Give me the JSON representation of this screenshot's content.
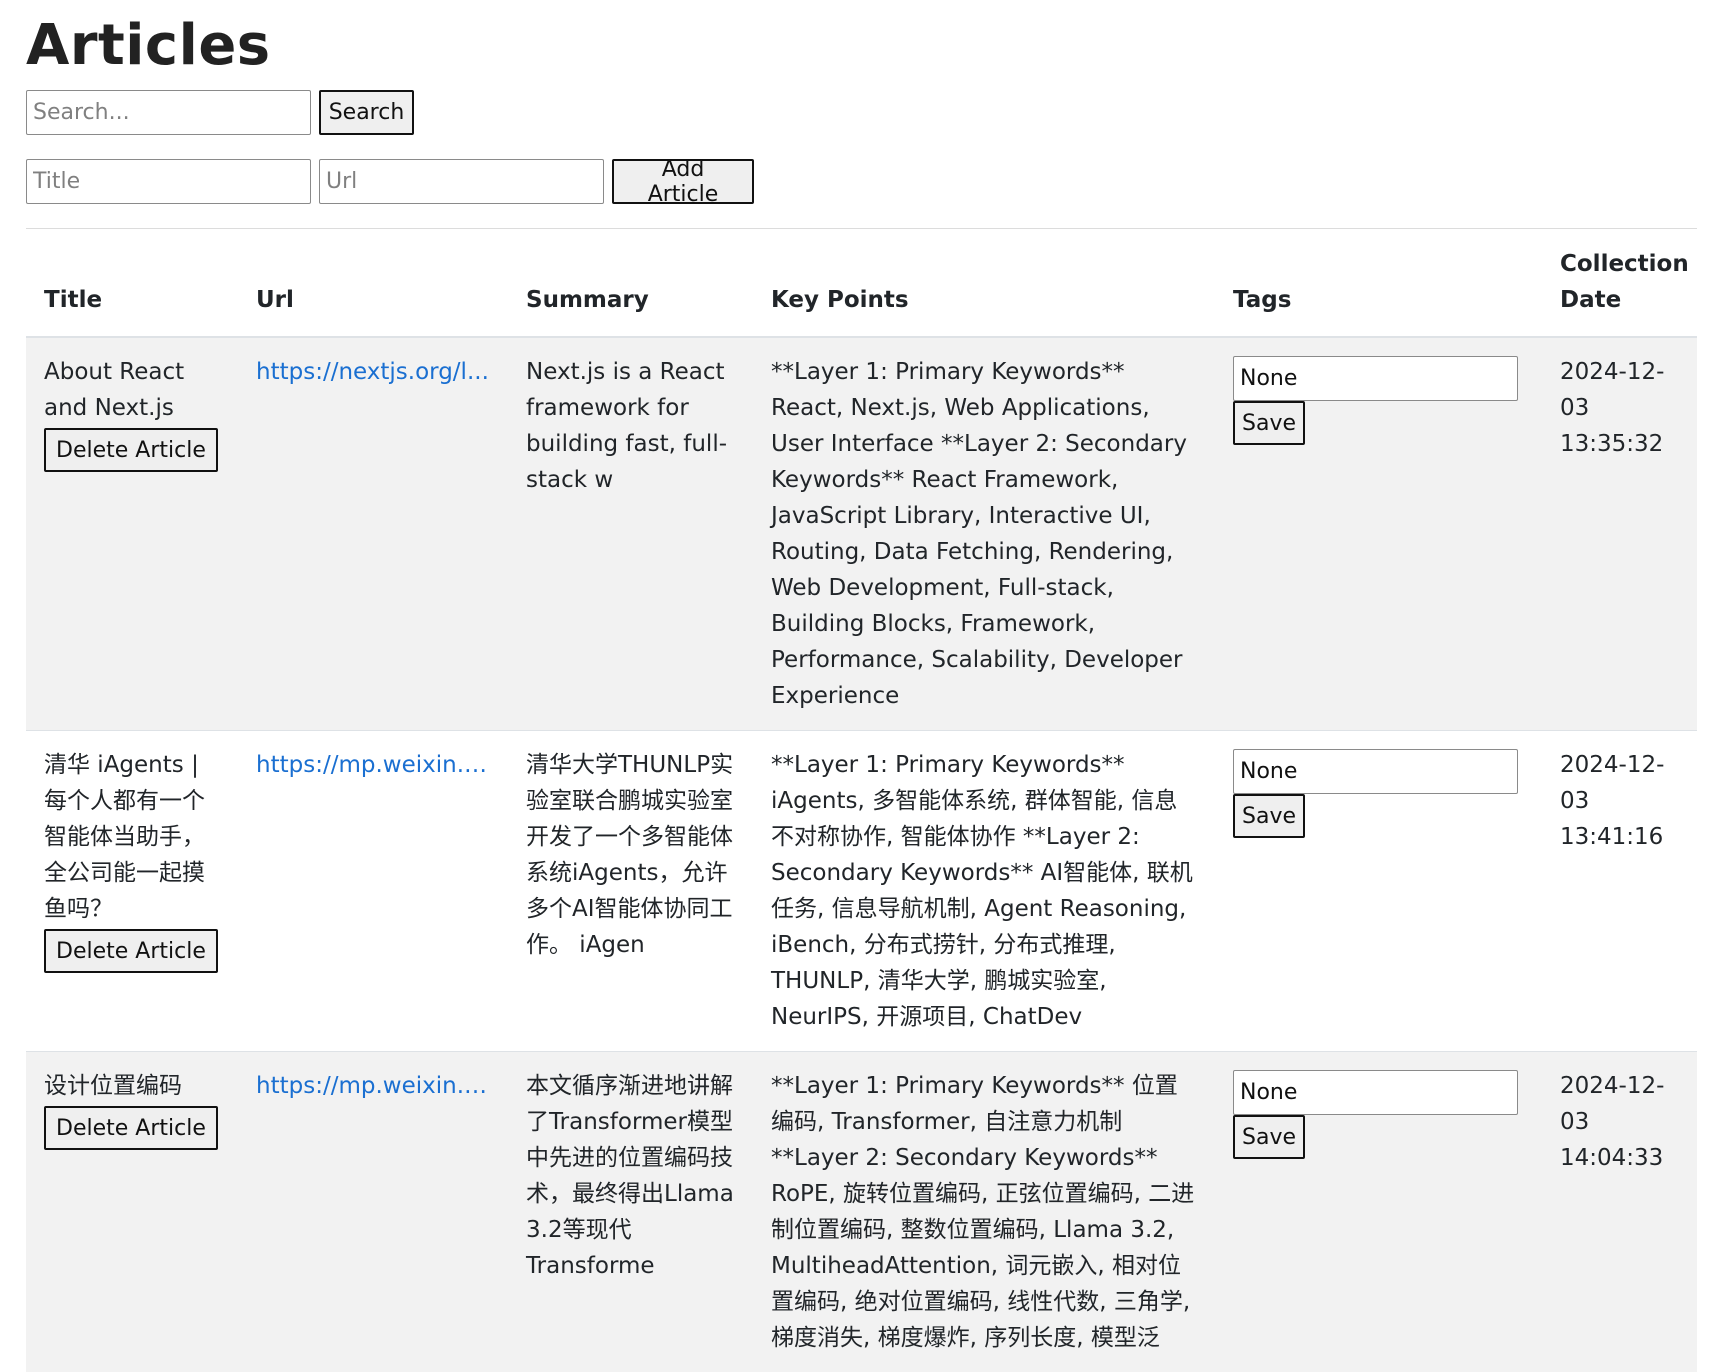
{
  "page": {
    "title": "Articles"
  },
  "search": {
    "placeholder": "Search...",
    "button_label": "Search"
  },
  "add_form": {
    "title_placeholder": "Title",
    "url_placeholder": "Url",
    "button_label": "Add Article"
  },
  "table": {
    "headers": {
      "title": "Title",
      "url": "Url",
      "summary": "Summary",
      "key_points": "Key Points",
      "tags": "Tags",
      "collection_date": "Collection Date"
    },
    "delete_label": "Delete Article",
    "save_label": "Save",
    "rows": [
      {
        "title": "About React and Next.js",
        "url": "https://nextjs.org/l...",
        "summary": "Next.js is a React framework for building fast, full-stack w",
        "key_points": "**Layer 1: Primary Keywords** React, Next.js, Web Applications, User Interface **Layer 2: Secondary Keywords** React Framework, JavaScript Library, Interactive UI, Routing, Data Fetching, Rendering, Web Development, Full-stack, Building Blocks, Framework, Performance, Scalability, Developer Experience",
        "tags": "None",
        "collection_date": "2024-12-03 13:35:32"
      },
      {
        "title": "清华 iAgents | 每个人都有一个智能体当助手，全公司能一起摸鱼吗？",
        "url": "https://mp.weixin.qq...",
        "summary": "清华大学THUNLP实验室联合鹏城实验室开发了一个多智能体系统iAgents，允许多个AI智能体协同工作。 iAgen",
        "key_points": "**Layer 1: Primary Keywords** iAgents, 多智能体系统, 群体智能, 信息不对称协作, 智能体协作 **Layer 2: Secondary Keywords** AI智能体, 联机任务, 信息导航机制, Agent Reasoning, iBench, 分布式捞针, 分布式推理, THUNLP, 清华大学, 鹏城实验室, NeurIPS, 开源项目, ChatDev",
        "tags": "None",
        "collection_date": "2024-12-03 13:41:16"
      },
      {
        "title": "设计位置编码",
        "url": "https://mp.weixin.qq...",
        "summary": "本文循序渐进地讲解了Transformer模型中先进的位置编码技术，最终得出Llama 3.2等现代Transforme",
        "key_points": "**Layer 1: Primary Keywords** 位置编码, Transformer, 自注意力机制 **Layer 2: Secondary Keywords** RoPE, 旋转位置编码, 正弦位置编码, 二进制位置编码, 整数位置编码, Llama 3.2, MultiheadAttention, 词元嵌入, 相对位置编码, 绝对位置编码, 线性代数, 三角学, 梯度消失, 梯度爆炸, 序列长度, 模型泛",
        "tags": "None",
        "collection_date": "2024-12-03 14:04:33"
      }
    ]
  }
}
